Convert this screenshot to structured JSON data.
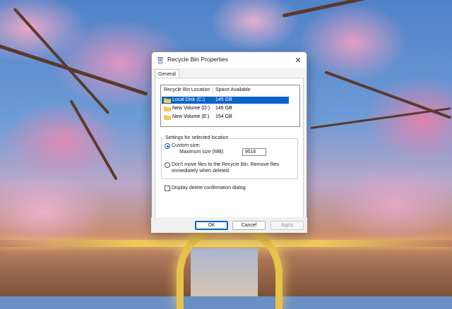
{
  "window": {
    "title": "Recycle Bin Properties",
    "close_glyph": "✕"
  },
  "tabs": [
    {
      "label": "General",
      "active": true
    }
  ],
  "locations": {
    "columns": [
      "Recycle Bin Location",
      "Space Available"
    ],
    "rows": [
      {
        "name": "Local Disk (C:)",
        "space": "145 GB",
        "selected": true
      },
      {
        "name": "New Volume (D:)",
        "space": "146 GB",
        "selected": false
      },
      {
        "name": "New Volume (E:)",
        "space": "154 GB",
        "selected": false
      }
    ]
  },
  "settings": {
    "group_label": "Settings for selected location",
    "custom_size_label": "Custom size:",
    "custom_size_selected": true,
    "max_size_label": "Maximum size (MB):",
    "max_size_value": "9516",
    "dont_move_label_line1": "Don't move files to the Recycle Bin. Remove files",
    "dont_move_label_line2": "immediately when deleted.",
    "dont_move_selected": false,
    "confirm_label": "Display delete confirmation dialog",
    "confirm_checked": false
  },
  "buttons": {
    "ok": "OK",
    "cancel": "Cancel",
    "apply": "Apply"
  },
  "colors": {
    "accent": "#0a64c8",
    "folder": "#e8b84a"
  },
  "icons": {
    "title": "recycle-bin-icon",
    "row": "folder-icon"
  }
}
